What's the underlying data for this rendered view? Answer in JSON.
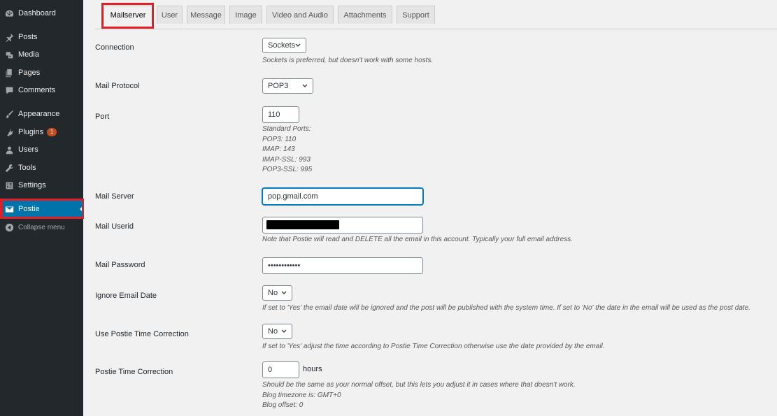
{
  "sidebar": {
    "items": [
      {
        "label": "Dashboard",
        "icon": "dashboard-icon"
      },
      {
        "label": "Posts",
        "icon": "pin-icon"
      },
      {
        "label": "Media",
        "icon": "media-icon"
      },
      {
        "label": "Pages",
        "icon": "pages-icon"
      },
      {
        "label": "Comments",
        "icon": "comments-icon"
      },
      {
        "label": "Appearance",
        "icon": "brush-icon"
      },
      {
        "label": "Plugins",
        "icon": "plugin-icon",
        "badge": "1"
      },
      {
        "label": "Users",
        "icon": "users-icon"
      },
      {
        "label": "Tools",
        "icon": "wrench-icon"
      },
      {
        "label": "Settings",
        "icon": "settings-icon"
      },
      {
        "label": "Postie",
        "icon": "mail-icon"
      },
      {
        "label": "Collapse menu",
        "icon": "collapse-icon"
      }
    ]
  },
  "tabs": [
    "Mailserver",
    "User",
    "Message",
    "Image",
    "Video and Audio",
    "Attachments",
    "Support"
  ],
  "form": {
    "connection": {
      "label": "Connection",
      "value": "Sockets",
      "desc": "Sockets is preferred, but doesn't work with some hosts."
    },
    "protocol": {
      "label": "Mail Protocol",
      "value": "POP3"
    },
    "port": {
      "label": "Port",
      "value": "110",
      "desc": [
        "Standard Ports:",
        "POP3: 110",
        "IMAP: 143",
        "IMAP-SSL: 993",
        "POP3-SSL: 995"
      ]
    },
    "server": {
      "label": "Mail Server",
      "value": "pop.gmail.com"
    },
    "userid": {
      "label": "Mail Userid",
      "desc": "Note that Postie will read and DELETE all the email in this account. Typically your full email address."
    },
    "password": {
      "label": "Mail Password",
      "value": "••••••••••••"
    },
    "ignore_date": {
      "label": "Ignore Email Date",
      "value": "No",
      "desc": "If set to 'Yes' the email date will be ignored and the post will be published with the system time. If set to 'No' the date in the email will be used as the post date."
    },
    "time_correction_use": {
      "label": "Use Postie Time Correction",
      "value": "No",
      "desc": "If set to 'Yes' adjust the time according to Postie Time Correction otherwise use the date provided by the email."
    },
    "time_correction": {
      "label": "Postie Time Correction",
      "value": "0",
      "suffix": "hours",
      "desc": [
        "Should be the same as your normal offset, but this lets you adjust it in cases where that doesn't work.",
        "Blog timezone is: GMT+0",
        "Blog offset: 0"
      ]
    }
  },
  "colors": {
    "accent": "#0073aa",
    "sidebar": "#23282d",
    "highlight": "#e31e24",
    "badge": "#ca4a1f"
  }
}
